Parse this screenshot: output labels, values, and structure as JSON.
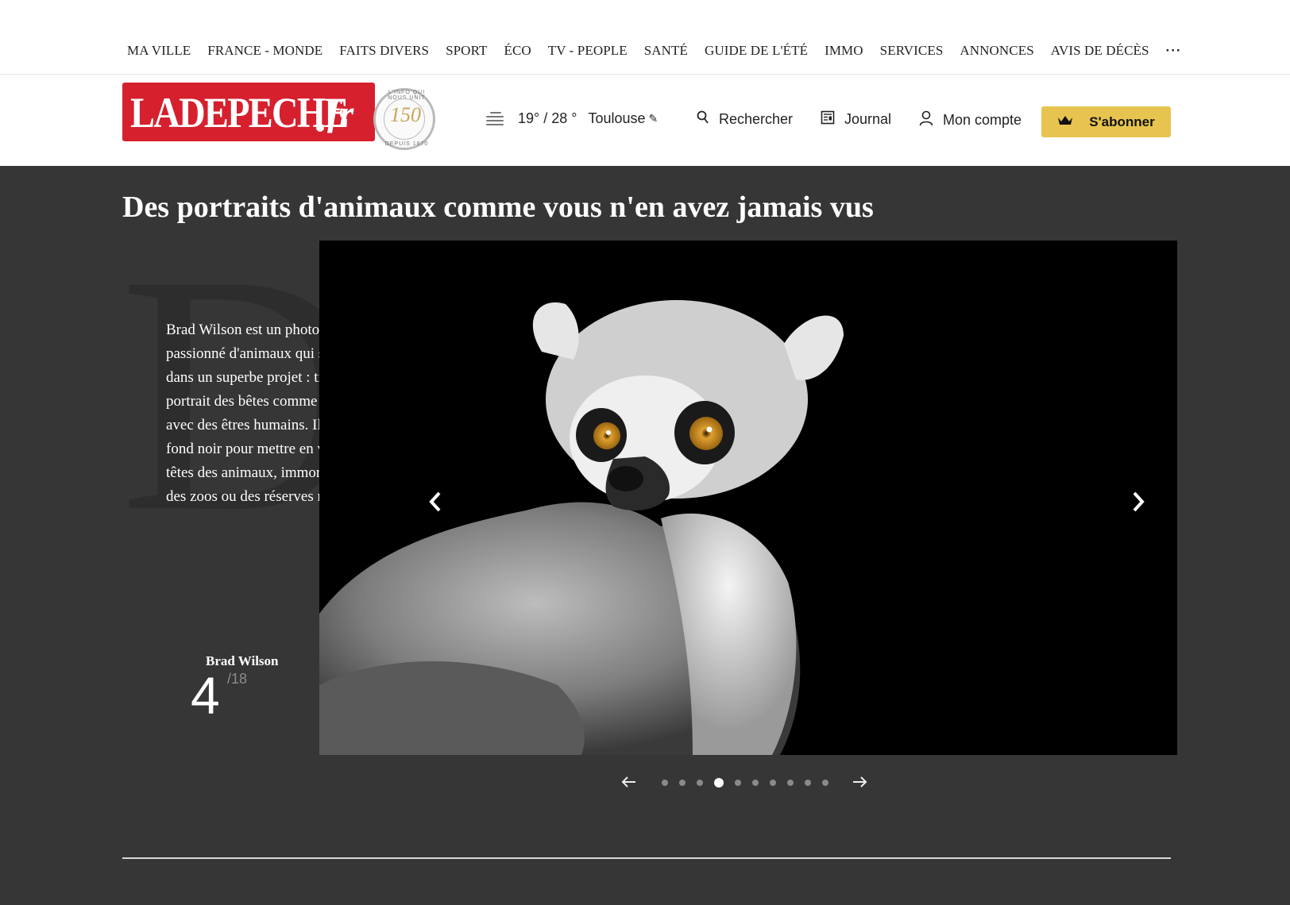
{
  "nav": {
    "items": [
      "MA VILLE",
      "FRANCE - MONDE",
      "FAITS DIVERS",
      "SPORT",
      "ÉCO",
      "TV - PEOPLE",
      "SANTÉ",
      "GUIDE DE L'ÉTÉ",
      "IMMO",
      "SERVICES",
      "ANNONCES",
      "AVIS DE DÉCÈS"
    ],
    "more": "···"
  },
  "header": {
    "logo_text": "LADEPECHE",
    "logo_suffix": "fr",
    "seal_number": "150",
    "seal_top": "L'INFO QUI NOUS UNIT",
    "seal_bottom": "DEPUIS 1870",
    "weather": {
      "temps": "19° / 28 °",
      "city": "Toulouse",
      "icon": "fog-icon"
    },
    "search_label": "Rechercher",
    "journal_label": "Journal",
    "account_label": "Mon compte",
    "subscribe_label": "S'abonner",
    "accent_color": "#d6202e",
    "subscribe_color": "#e7c44f"
  },
  "article": {
    "title": "Des portraits d'animaux comme vous n'en avez jamais vus",
    "dropcap": "D",
    "intro": "Brad Wilson est un photographe passionné d'animaux qui s'est lancé dans un superbe projet : tirer le portrait des bêtes comme il le ferait avec des êtres humains. Il utilise un fond noir pour mettre en valeur les têtes des animaux, immortalisés dans des zoos ou des réserves naturelles.",
    "photo_credit": "Brad Wilson",
    "current_slide": "4",
    "total_slides": "/18",
    "active_dot": 4,
    "dot_count": 10
  }
}
